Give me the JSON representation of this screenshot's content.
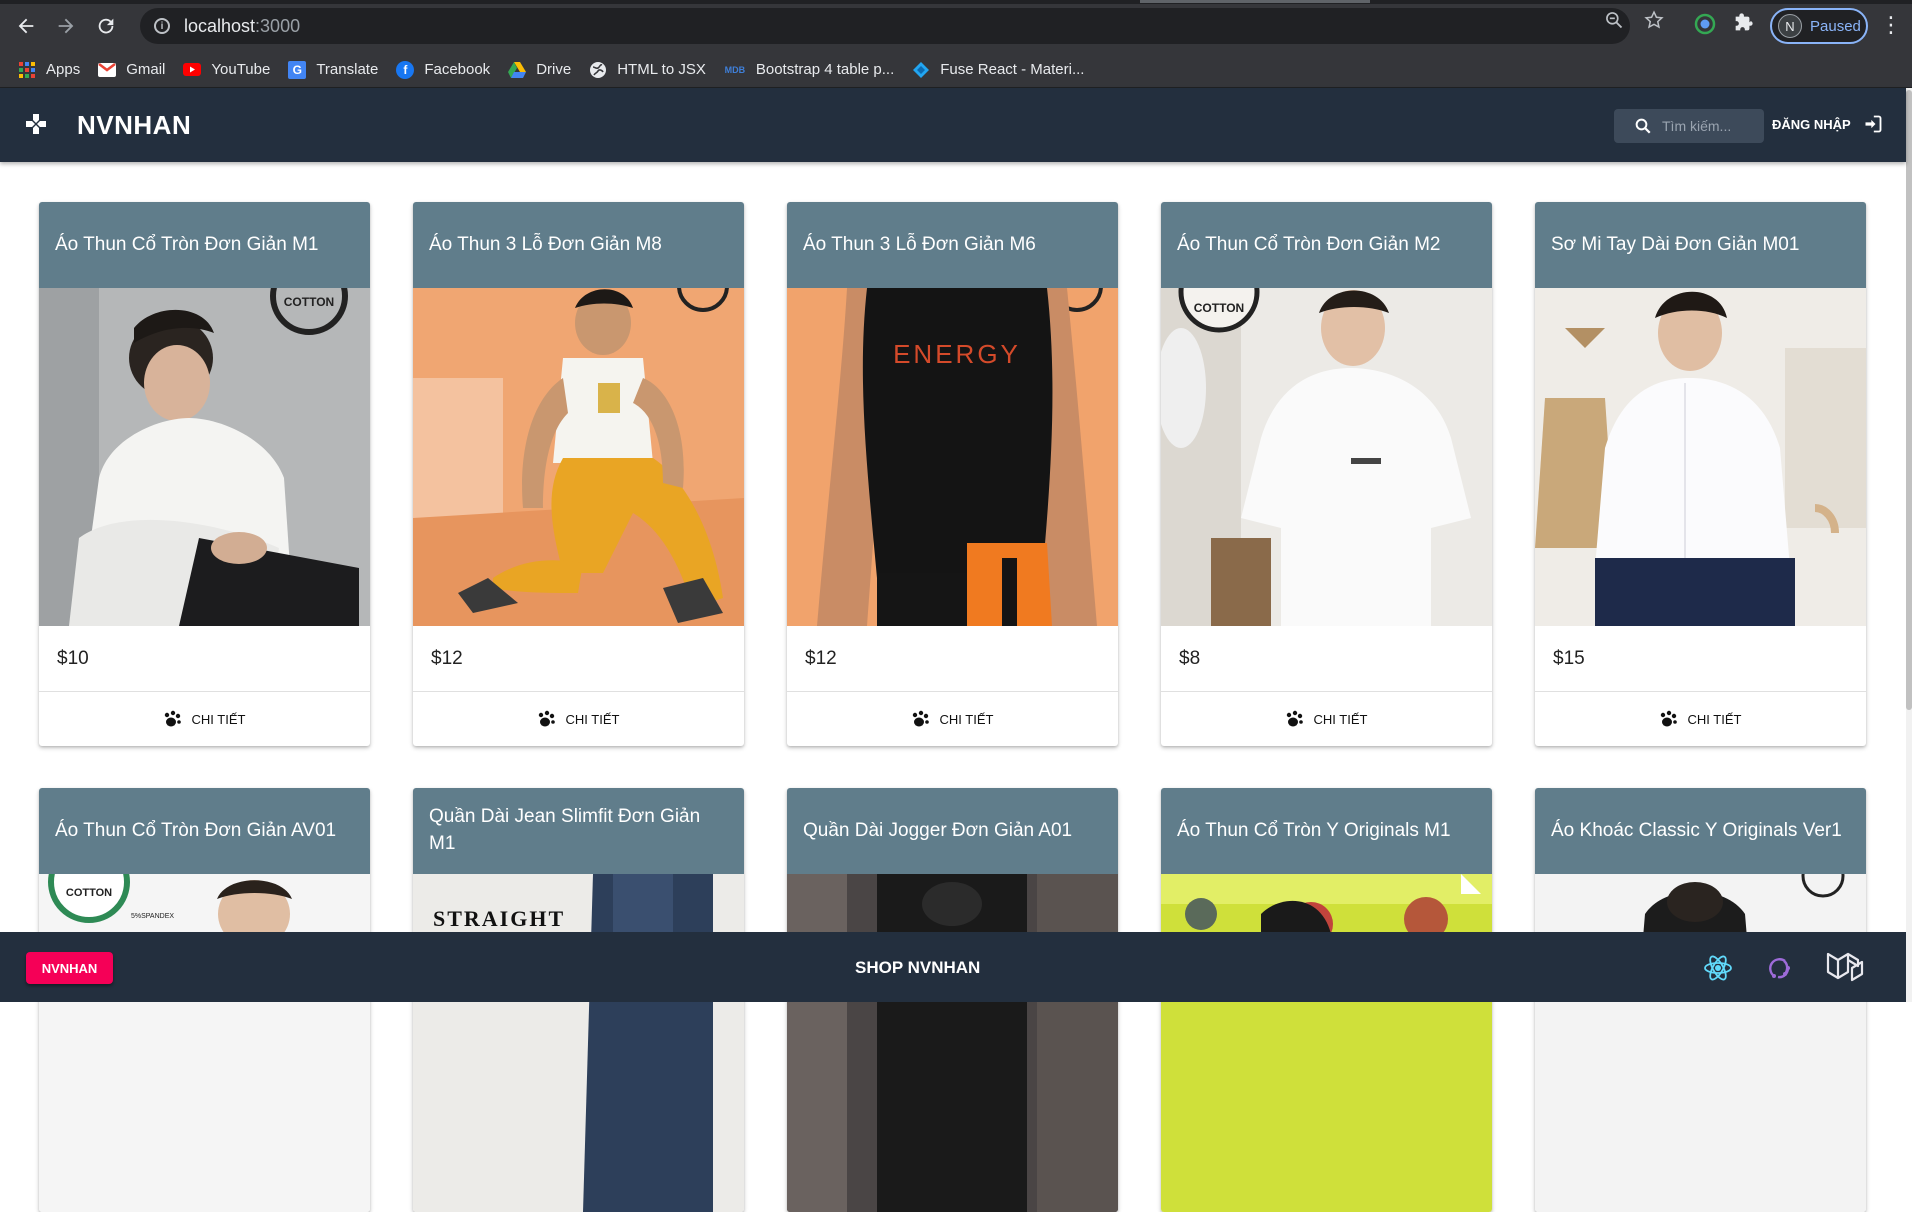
{
  "browser": {
    "url_host": "localhost",
    "url_port": ":3000",
    "profile_initial": "N",
    "profile_status": "Paused",
    "bookmarks": [
      {
        "label": "Apps",
        "icon": "apps-grid-icon"
      },
      {
        "label": "Gmail",
        "icon": "gmail-icon"
      },
      {
        "label": "YouTube",
        "icon": "youtube-icon"
      },
      {
        "label": "Translate",
        "icon": "translate-icon"
      },
      {
        "label": "Facebook",
        "icon": "facebook-icon"
      },
      {
        "label": "Drive",
        "icon": "drive-icon"
      },
      {
        "label": "HTML to JSX",
        "icon": "globe-icon"
      },
      {
        "label": "Bootstrap 4 table p...",
        "icon": "mdb-icon"
      },
      {
        "label": "Fuse React - Materi...",
        "icon": "fuse-icon"
      }
    ]
  },
  "appbar": {
    "brand": "NVNHAN",
    "search_placeholder": "Tìm kiếm...",
    "login_label": "ĐĂNG NHẬP"
  },
  "products": [
    {
      "title": "Áo Thun Cổ Tròn Đơn Giản M1",
      "price": "$10",
      "action": "CHI TIẾT"
    },
    {
      "title": "Áo Thun 3 Lỗ Đơn Giản M8",
      "price": "$12",
      "action": "CHI TIẾT"
    },
    {
      "title": "Áo Thun 3 Lỗ Đơn Giản M6",
      "price": "$12",
      "action": "CHI TIẾT"
    },
    {
      "title": "Áo Thun Cổ Tròn Đơn Giản M2",
      "price": "$8",
      "action": "CHI TIẾT"
    },
    {
      "title": "Sơ Mi Tay Dài Đơn Giản M01",
      "price": "$15",
      "action": "CHI TIẾT"
    },
    {
      "title": "Áo Thun Cổ Tròn Đơn Giản AV01",
      "price": "",
      "action": ""
    },
    {
      "title": "Quần Dài Jean Slimfit Đơn Giản M1",
      "price": "",
      "action": ""
    },
    {
      "title": "Quần Dài Jogger Đơn Giản A01",
      "price": "",
      "action": ""
    },
    {
      "title": "Áo Thun Cổ Tròn Y Originals M1",
      "price": "",
      "action": ""
    },
    {
      "title": "Áo Khoác Classic Y Originals Ver1",
      "price": "",
      "action": ""
    }
  ],
  "image_text": {
    "cotton": "COTTON",
    "energy": "ENERGY",
    "straight": "STRAIGHT",
    "spandex": "5%SPANDEX"
  },
  "footer": {
    "button_label": "NVNHAN",
    "shop_name": "SHOP NVNHAN"
  }
}
